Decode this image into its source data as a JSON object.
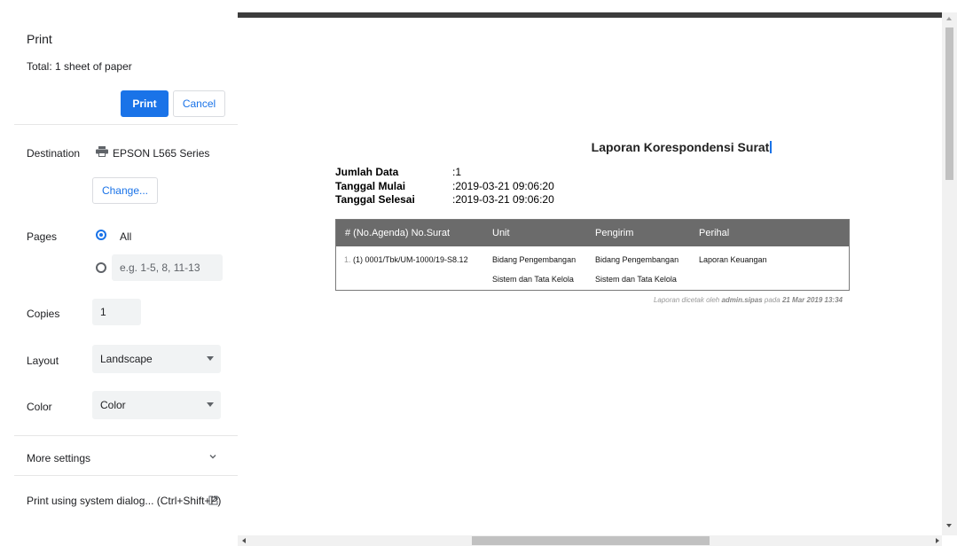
{
  "panel": {
    "title": "Print",
    "total": "Total: 1 sheet of paper",
    "print_label": "Print",
    "cancel_label": "Cancel",
    "destination_label": "Destination",
    "destination_value": "EPSON L565 Series",
    "change_label": "Change...",
    "pages_label": "Pages",
    "pages_all": "All",
    "pages_placeholder": "e.g. 1-5, 8, 11-13",
    "copies_label": "Copies",
    "copies_value": "1",
    "layout_label": "Layout",
    "layout_value": "Landscape",
    "color_label": "Color",
    "color_value": "Color",
    "more_settings": "More settings",
    "system_dialog": "Print using system dialog... (Ctrl+Shift+P)"
  },
  "preview": {
    "title": "Laporan Korespondensi Surat",
    "meta": [
      {
        "key": "Jumlah Data",
        "value": ":1"
      },
      {
        "key": "Tanggal Mulai",
        "value": ":2019-03-21 09:06:20"
      },
      {
        "key": "Tanggal Selesai",
        "value": ":2019-03-21 09:06:20"
      }
    ],
    "table": {
      "headers": [
        "# (No.Agenda) No.Surat",
        "Unit",
        "Pengirim",
        "Perihal"
      ],
      "row": {
        "num": "1.",
        "no_surat": "(1) 0001/Tbk/UM-1000/19-S8.12",
        "unit_line1": "Bidang Pengembangan",
        "unit_line2": "Sistem dan Tata Kelola",
        "pengirim_line1": "Bidang Pengembangan",
        "pengirim_line2": "Sistem dan Tata Kelola",
        "perihal": "Laporan Keuangan"
      }
    },
    "footnote_prefix": "Laporan dicetak oleh ",
    "footnote_user": "admin.sipas",
    "footnote_mid": " pada ",
    "footnote_date": "21 Mar 2019 13:34"
  },
  "colors": {
    "accent": "#1a73e8",
    "table_header": "#6b6b6b"
  }
}
